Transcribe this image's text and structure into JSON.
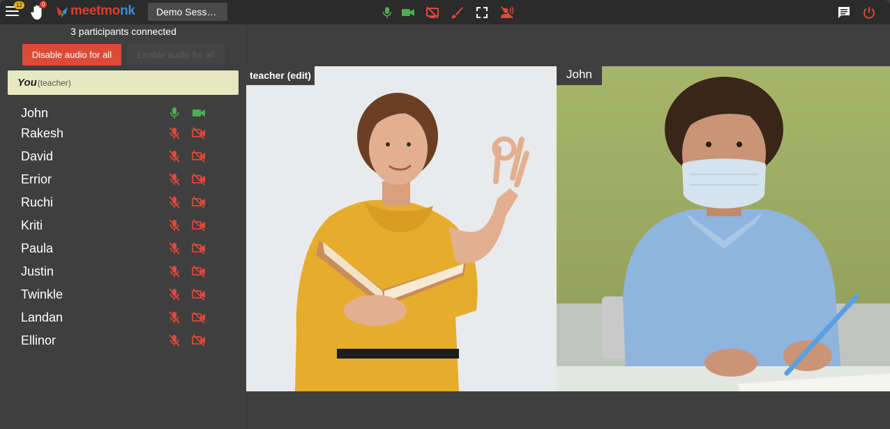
{
  "topbar": {
    "menu_badge": "12",
    "hand_badge": "0",
    "logo_text_a": "meetm",
    "logo_text_o": "o",
    "logo_text_b": "nk",
    "session_title": "Demo Sess…"
  },
  "sidebar": {
    "participants_count": "3 participants connected",
    "disable_audio_label": "Disable audio for all",
    "enable_audio_label": "Enable audio for all",
    "self_name": "You",
    "self_role": "(teacher)",
    "participants": [
      {
        "name": "John",
        "audio": "on",
        "video": "on"
      },
      {
        "name": "Rakesh",
        "audio": "off",
        "video": "off"
      },
      {
        "name": "David",
        "audio": "off",
        "video": "off"
      },
      {
        "name": "Errior",
        "audio": "off",
        "video": "off"
      },
      {
        "name": "Ruchi",
        "audio": "off",
        "video": "off"
      },
      {
        "name": "Kriti",
        "audio": "off",
        "video": "off"
      },
      {
        "name": "Paula",
        "audio": "off",
        "video": "off"
      },
      {
        "name": "Justin",
        "audio": "off",
        "video": "off"
      },
      {
        "name": "Twinkle",
        "audio": "off",
        "video": "off"
      },
      {
        "name": "Landan",
        "audio": "off",
        "video": "off"
      },
      {
        "name": "Ellinor",
        "audio": "off",
        "video": "off"
      }
    ]
  },
  "videos": {
    "teacher_label": "teacher (edit)",
    "student_label": "John"
  },
  "colors": {
    "on_green": "#4caf50",
    "off_red": "#e0483a",
    "accent_red": "#dd4a37"
  }
}
